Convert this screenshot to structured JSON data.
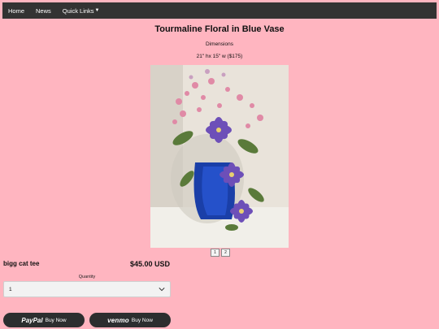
{
  "nav": {
    "home": "Home",
    "news": "News",
    "quick_links": "Quick Links"
  },
  "product": {
    "title": "Tourmaline Floral in Blue Vase",
    "dimensions_label": "Dimensions",
    "dimensions_value": "21\" hx 15\" w ($175)",
    "image_icon": "flower-arrangement-photo",
    "pages": [
      "1",
      "2"
    ],
    "name": "bigg cat tee",
    "price": "$45.00 USD"
  },
  "quantity": {
    "label": "Quantity",
    "value": "1"
  },
  "payment": {
    "paypal_brand": "PayPal",
    "paypal_label": "Buy Now",
    "venmo_brand": "venmo",
    "venmo_label": "Buy Now"
  },
  "colors": {
    "background": "#ffb5c0",
    "navbar": "#333333",
    "pay_button": "#2c2e2f"
  }
}
